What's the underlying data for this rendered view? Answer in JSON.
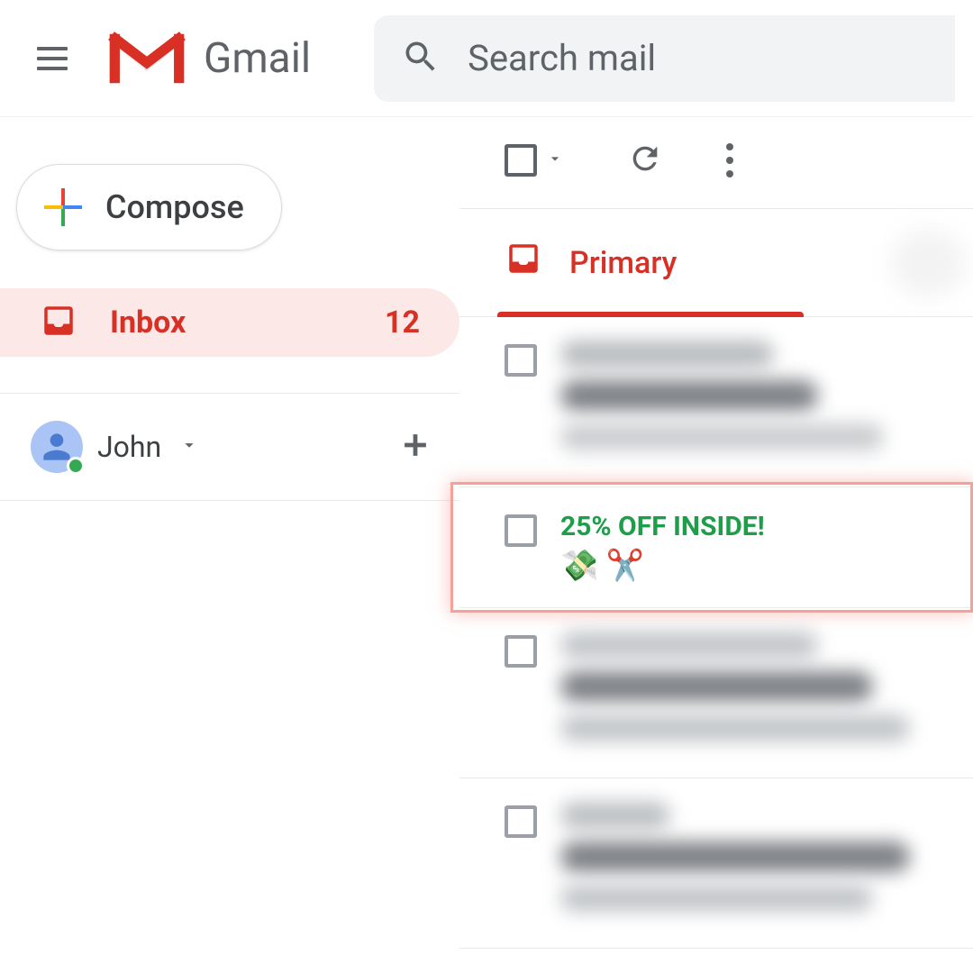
{
  "header": {
    "app_name": "Gmail",
    "search_placeholder": "Search mail"
  },
  "sidebar": {
    "compose_label": "Compose",
    "inbox_label": "Inbox",
    "inbox_count": "12",
    "chat": {
      "user_name": "John"
    }
  },
  "main": {
    "tab_label": "Primary",
    "highlighted_email": {
      "subject": "25% OFF INSIDE!",
      "emoji": "💸 ✂️"
    }
  }
}
